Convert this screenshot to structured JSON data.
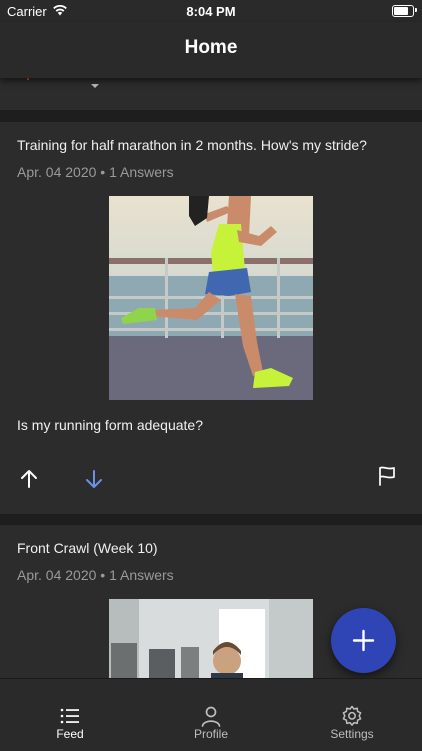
{
  "status_bar": {
    "carrier": "Carrier",
    "time": "8:04 PM",
    "battery_level": 0.9
  },
  "header": {
    "title": "Home"
  },
  "feed": {
    "posts": [
      {
        "title": "Training for half marathon in 2 months. How's my stride?",
        "meta": "Apr. 04 2020 • 1 Answers",
        "body": "Is my running form adequate?",
        "vote": "downvoted"
      },
      {
        "title": "Front Crawl (Week 10)",
        "meta": "Apr. 04 2020 • 1 Answers"
      }
    ]
  },
  "tab_bar": {
    "items": [
      {
        "label": "Feed",
        "icon": "list-icon",
        "active": true
      },
      {
        "label": "Profile",
        "icon": "person-icon",
        "active": false
      },
      {
        "label": "Settings",
        "icon": "gear-icon",
        "active": false
      }
    ]
  },
  "colors": {
    "accent": "#2f45b6",
    "downvote": "#6e8fe8",
    "background": "#1e1e1e",
    "card": "#2c2c2c"
  }
}
